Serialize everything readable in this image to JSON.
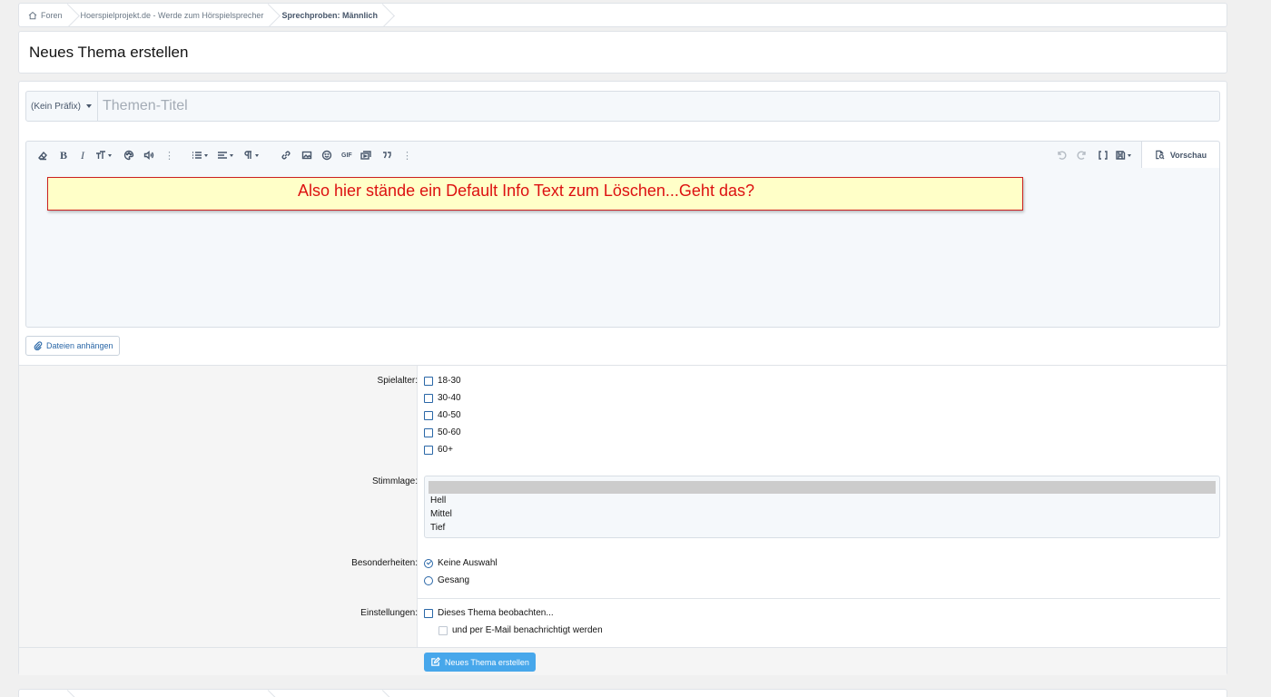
{
  "breadcrumb": {
    "items": [
      "Foren",
      "Hoerspielprojekt.de - Werde zum Hörspielsprecher",
      "Sprechproben: Männlich"
    ]
  },
  "page": {
    "title": "Neues Thema erstellen"
  },
  "thread_title": {
    "prefix_label": "(Kein Präfix)",
    "placeholder": "Themen-Titel",
    "value": ""
  },
  "editor": {
    "toolbar_icons": [
      "eraser-icon",
      "bold-icon",
      "italic-icon",
      "text-size-icon",
      "palette-icon",
      "audio-icon",
      "more-icon",
      "list-icon",
      "align-icon",
      "paragraph-icon",
      "link-icon",
      "image-icon",
      "smiley-icon",
      "gif-icon",
      "media-icon",
      "quote-icon",
      "more-icon",
      "undo-icon",
      "redo-icon",
      "bbcode-icon",
      "save-draft-icon"
    ],
    "bold_glyph": "B",
    "italic_glyph": "I",
    "gif_glyph": "GIF",
    "preview_label": "Vorschau",
    "info_text": "Also hier stände ein Default Info Text zum Löschen...Geht das?"
  },
  "attach": {
    "label": "Dateien anhängen"
  },
  "fields": {
    "spielalter": {
      "label": "Spielalter:",
      "options": [
        "18-30",
        "30-40",
        "40-50",
        "50-60",
        "60+"
      ]
    },
    "stimmlage": {
      "label": "Stimmlage:",
      "options": [
        "",
        "Hell",
        "Mittel",
        "Tief"
      ]
    },
    "besonderheiten": {
      "label": "Besonderheiten:",
      "options": [
        "Keine Auswahl",
        "Gesang"
      ],
      "selected": "Keine Auswahl"
    },
    "einstellungen": {
      "label": "Einstellungen:",
      "watch_label": "Dieses Thema beobachten...",
      "email_label": "und per E-Mail benachrichtigt werden"
    }
  },
  "submit": {
    "label": "Neues Thema erstellen"
  },
  "colors": {
    "accent": "#47a7eb",
    "info_bg": "#ffffc8",
    "info_text": "#dd1111",
    "link": "#2a67a7"
  }
}
